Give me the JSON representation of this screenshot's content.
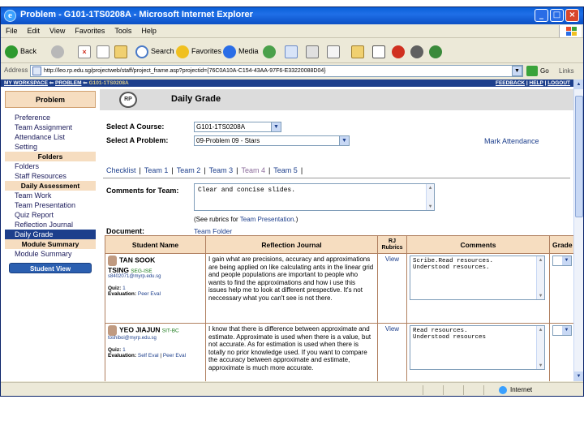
{
  "window": {
    "title": "Problem - G101-1TS0208A - Microsoft Internet Explorer",
    "minimize": "_",
    "maximize": "□",
    "close": "×"
  },
  "menu": [
    "File",
    "Edit",
    "View",
    "Favorites",
    "Tools",
    "Help"
  ],
  "toolbar": {
    "back": "Back",
    "search": "Search",
    "favorites": "Favorites",
    "media": "Media"
  },
  "address": {
    "label": "Address",
    "url": "http://leo.rp.edu.sg/projectweb/staff/project_frame.asp?projectid={76C0A10A-C154-43AA-97F6-E33220088D04}",
    "go": "Go",
    "links": "Links"
  },
  "topnav": {
    "workspace": "MY WORKSPACE",
    "problem": "PROBLEM",
    "course": "G101-1TS0208A",
    "feedback": "FEEDBACK",
    "help": "HELP",
    "logout": "LOGOUT"
  },
  "sidebar": {
    "header": "Problem",
    "items_top": [
      "Preference",
      "Team Assignment",
      "Attendance List",
      "Setting"
    ],
    "folders_title": "Folders",
    "folder_items": [
      "Folders",
      "Staff Resources"
    ],
    "daily_title": "Daily Assessment",
    "daily_items": [
      "Team Work",
      "Team Presentation",
      "Quiz Report",
      "Reflection Journal",
      "Daily Grade"
    ],
    "module_title": "Module Summary",
    "module_items": [
      "Module Summary"
    ],
    "student_view": "Student View"
  },
  "main": {
    "logo": "RP",
    "title": "Daily Grade",
    "course_label": "Select A Course:",
    "course_value": "G101-1TS0208A",
    "problem_label": "Select A Problem:",
    "problem_value": "09-Problem 09 - Stars",
    "mark_attendance": "Mark Attendance",
    "tabs": [
      "Checklist",
      "Team 1",
      "Team 2",
      "Team 3",
      "Team 4",
      "Team 5"
    ],
    "comments_label": "Comments for Team:",
    "comments_value": "Clear and concise slides.",
    "rubrics_prefix": "(See rubrics for ",
    "rubrics_link": "Team Presentation",
    "rubrics_suffix": ".)",
    "document_label": "Document:",
    "document_link": "Team Folder"
  },
  "table": {
    "headers": {
      "student": "Student Name",
      "reflection": "Reflection Journal",
      "rubrics": "RJ Rubrics",
      "comments": "Comments",
      "grade": "Grade"
    },
    "quiz_label": "Quiz:",
    "eval_label": "Evaluation:",
    "rows": [
      {
        "name": "TAN SOOK TSING",
        "name_line1": "TAN SOOK",
        "name_line2": "TSING",
        "program": "SEG-ISE",
        "email": "s8402071@myrp.edu.sg",
        "quiz": "1",
        "eval": "Peer Eval",
        "journal": "I gain what are precisions, accuracy and approximations are being applied on like calculating ants in the linear grid and people populations are important to people who wants to find the approximations and how i use this issues help me to look at different prespective. It's not neccessary what you can't see is not there.",
        "rubric_link": "View",
        "comment": "Scribe.Read resources.\nUnderstood resources."
      },
      {
        "name": "YEO JIAJUN",
        "program": "SIT-BC",
        "email": "toshiboi@myrp.edu.sg",
        "quiz": "1",
        "eval": "Self Eval",
        "eval2": "Peer Eval",
        "journal": "I know that there is difference between approximate and estimate. Approximate is used when there is a value, but not accurate. As for estimation is used when there is totally no prior knowledge used. If you want to compare the accuracy between approximate and estimate, approximate is much more accurate.",
        "rubric_link": "View",
        "comment": "Read resources.\nUnderstood resources"
      }
    ]
  },
  "status": {
    "zone": "Internet"
  },
  "colors": {
    "nav_blue": "#1d3f8c",
    "section_peach": "#f6ddc0",
    "titlebar_blue": "#0a5fd8"
  }
}
